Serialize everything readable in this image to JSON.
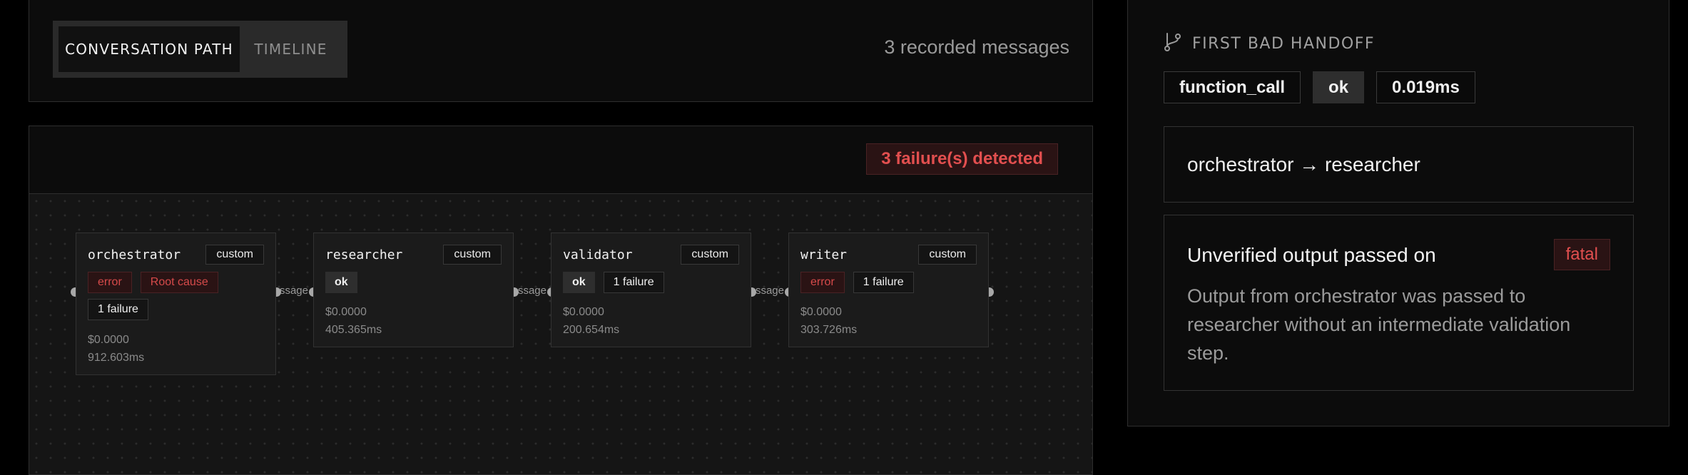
{
  "tabs": {
    "conversation_path": "CONVERSATION PATH",
    "timeline": "TIMELINE",
    "active": "conversation_path"
  },
  "message_count": "3 recorded messages",
  "graph": {
    "failures_badge": "3 failure(s) detected",
    "edge_label": "message",
    "nodes": [
      {
        "name": "orchestrator",
        "type": "custom",
        "status": "error",
        "root_cause": "Root cause",
        "failures": "1 failure",
        "cost": "$0.0000",
        "duration": "912.603ms"
      },
      {
        "name": "researcher",
        "type": "custom",
        "status": "ok",
        "root_cause": null,
        "failures": null,
        "cost": "$0.0000",
        "duration": "405.365ms"
      },
      {
        "name": "validator",
        "type": "custom",
        "status": "ok",
        "root_cause": null,
        "failures": "1 failure",
        "cost": "$0.0000",
        "duration": "200.654ms"
      },
      {
        "name": "writer",
        "type": "custom",
        "status": "error",
        "root_cause": null,
        "failures": "1 failure",
        "cost": "$0.0000",
        "duration": "303.726ms"
      }
    ]
  },
  "handoff": {
    "icon": "git-branch-icon",
    "title": "FIRST BAD HANDOFF",
    "kind": "function_call",
    "status": "ok",
    "latency": "0.019ms",
    "route": "orchestrator → researcher",
    "issue_title": "Unverified output passed on",
    "severity": "fatal",
    "issue_description": "Output from orchestrator was passed to researcher without an intermediate validation step."
  },
  "colors": {
    "background": "#000000",
    "panel": "#0c0c0c",
    "error_text": "#e24f4f",
    "error_bg": "#2a1314",
    "ok_bg": "#2e2e2e"
  }
}
